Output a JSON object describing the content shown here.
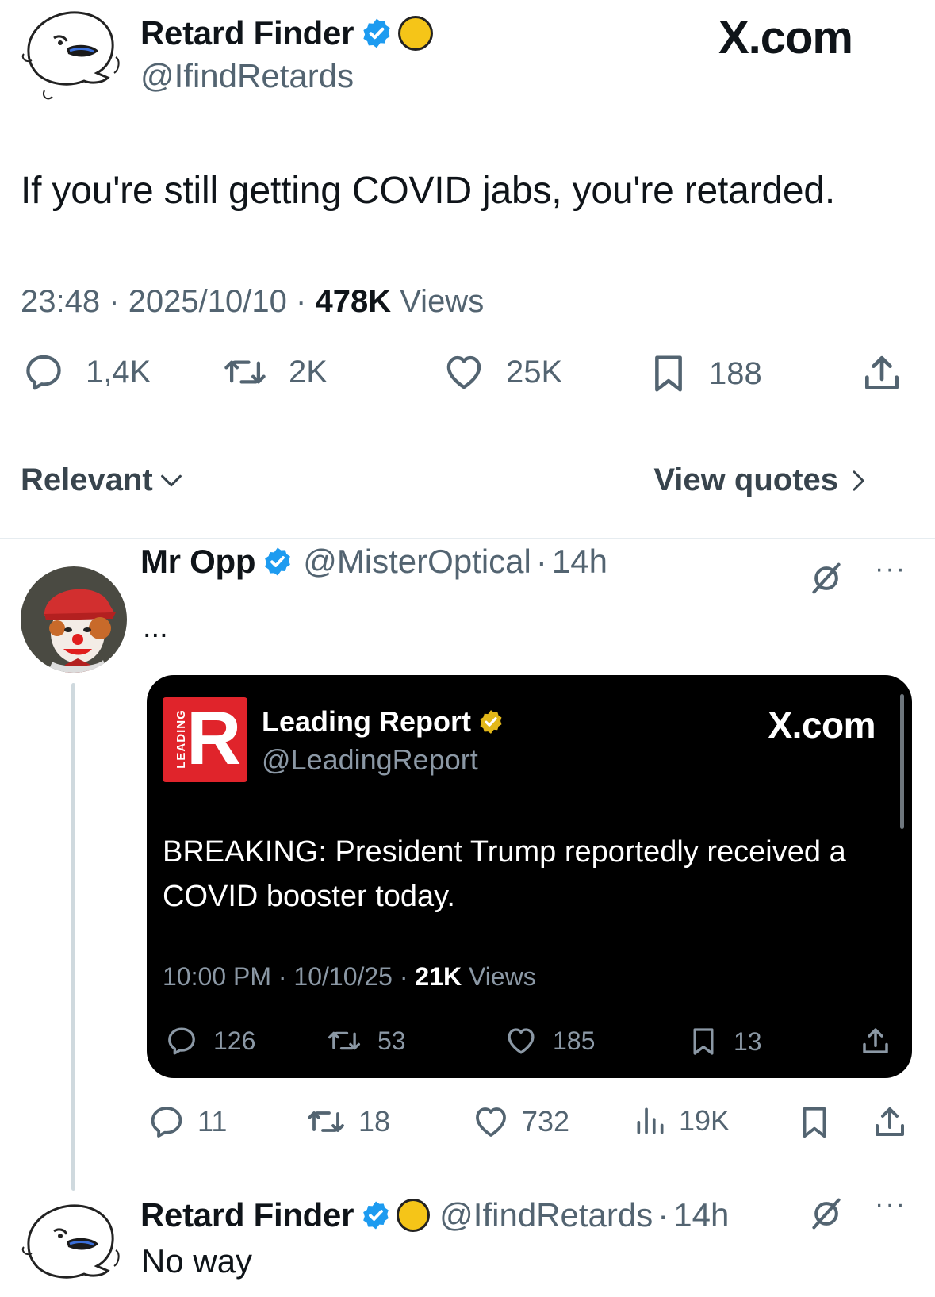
{
  "main_tweet": {
    "author_name": "Retard Finder",
    "author_handle": "@IfindRetards",
    "watermark": "X.com",
    "text": "If you're still getting COVID jabs, you're retarded.",
    "time": "23:48",
    "date": "2025/10/10",
    "views_count": "478K",
    "views_label": "Views",
    "sep": "·",
    "stats": {
      "replies": "1,4K",
      "reposts": "2K",
      "likes": "25K",
      "bookmarks": "188"
    },
    "sort_label": "Relevant",
    "view_quotes_label": "View quotes"
  },
  "reply": {
    "author_name": "Mr Opp",
    "author_handle": "@MisterOptical",
    "age": "14h",
    "text": "...",
    "embed": {
      "author_name": "Leading Report",
      "author_handle": "@LeadingReport",
      "logo_letter": "R",
      "logo_vertical_text": "LEADING",
      "watermark": "X.com",
      "text": "BREAKING: President Trump reportedly received a COVID booster today.",
      "time": "10:00 PM",
      "date": "10/10/25",
      "views_count": "21K",
      "views_label": "Views",
      "stats": {
        "replies": "126",
        "reposts": "53",
        "likes": "185",
        "bookmarks": "13"
      }
    },
    "stats": {
      "replies": "11",
      "reposts": "18",
      "likes": "732",
      "views": "19K"
    }
  },
  "second_reply": {
    "author_name": "Retard Finder",
    "author_handle": "@IfindRetards",
    "age": "14h",
    "text": "No way"
  },
  "colors": {
    "verified_blue": "#1d9bf0",
    "verified_gold": "#e2b719",
    "emoji_yellow": "#f5c518",
    "logo_red": "#e0242b"
  },
  "icons": [
    "reply-icon",
    "repost-icon",
    "like-icon",
    "bookmark-icon",
    "share-icon",
    "views-icon",
    "grok-icon",
    "more-icon",
    "chevron-down-icon",
    "chevron-right-icon",
    "verified-badge-icon"
  ]
}
